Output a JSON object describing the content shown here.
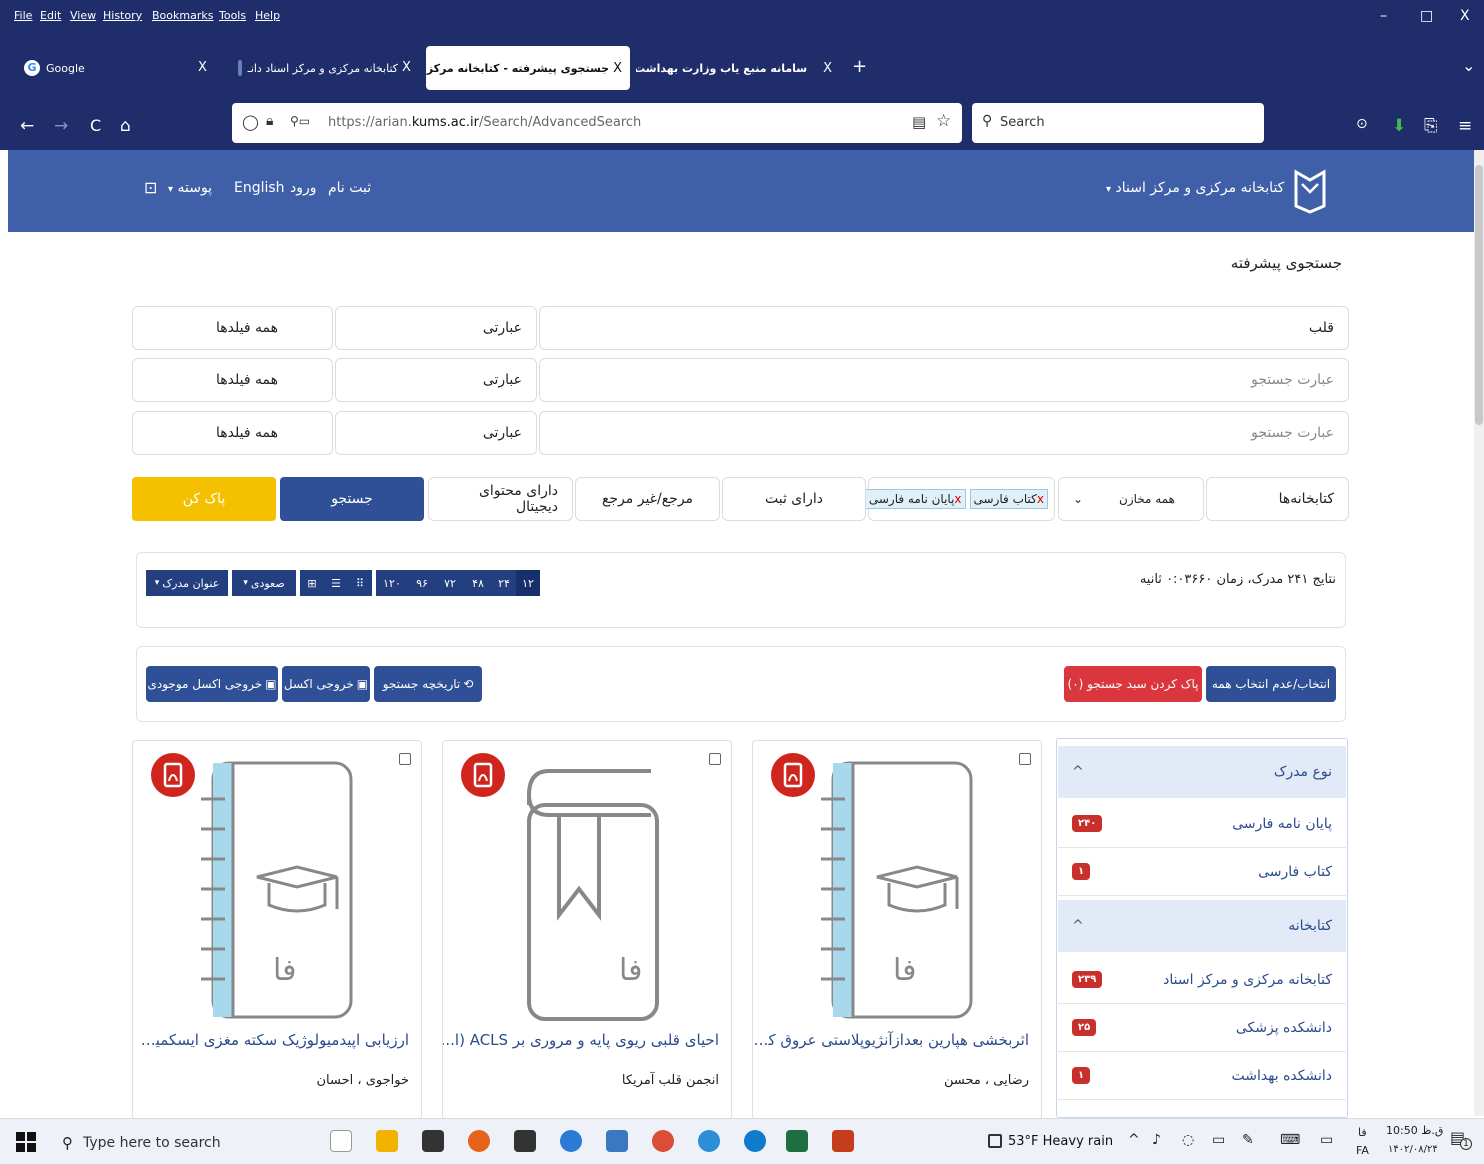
{
  "menubar": {
    "items": [
      "File",
      "Edit",
      "View",
      "History",
      "Bookmarks",
      "Tools",
      "Help"
    ],
    "min": "–",
    "max": "□",
    "close": "X"
  },
  "tabs": {
    "google": {
      "label": "Google",
      "close": "X"
    },
    "library": {
      "label": "کتابخانه مرکزی و مرکز اسناد دانـ",
      "close": "X"
    },
    "advanced": {
      "label": "جستجوی پیشرفته - کتابخانه مرکز",
      "close": "X"
    },
    "ministry": {
      "label": "سامانه منبع یاب وزارت بهداشت",
      "close": "X"
    },
    "new_tab": "+",
    "list_tabs": "⌄"
  },
  "nav": {
    "back": "←",
    "forward": "→",
    "reload": "C",
    "home": "⌂",
    "url_prefix": "https://arian.",
    "url_domain": "kums.ac.ir",
    "url_path": "/Search/AdvancedSearch",
    "search_placeholder": "Search",
    "reader": "▤",
    "star": "☆",
    "shield": "⊙",
    "download": "⬇",
    "share": "⎘",
    "menu": "≡"
  },
  "site": {
    "logo_title": "کتابخانه مرکزی و مرکز اسناد",
    "logo_caret": "▾",
    "nav_links": [
      "ثبت نام",
      "ورود",
      "English",
      "پوسته"
    ],
    "cart": "⊡",
    "caret": "▾"
  },
  "page": {
    "title": "جستجوی پیشرفته"
  },
  "search_rows": [
    {
      "term": "قلب",
      "is_placeholder": false,
      "mode": "عبارتی",
      "field": "همه فیلدها"
    },
    {
      "term": "عبارت جستجو",
      "is_placeholder": true,
      "mode": "عبارتی",
      "field": "همه فیلدها"
    },
    {
      "term": "عبارت جستجو",
      "is_placeholder": true,
      "mode": "عبارتی",
      "field": "همه فیلدها"
    }
  ],
  "filters": {
    "libraries_label": "کتابخانه‌ها",
    "repos": "همه مخازن",
    "tag1": "کتاب فارسی",
    "tag2": "پایان نامه فارسی",
    "registered": "دارای ثبت",
    "reference": "مرجع/غیر مرجع",
    "digital": "دارای محتوای دیجیتال",
    "search_btn": "جستجو",
    "clear_btn": "پاک کن"
  },
  "results": {
    "summary": "نتایج ۲۴۱ مدرک، زمان ۰:۰۳۶۶۰ ثانیه",
    "page_sizes": [
      "۱۲",
      "۲۴",
      "۴۸",
      "۷۲",
      "۹۶",
      "۱۲۰"
    ],
    "sort_field": "عنوان مدرک",
    "sort_dir": "صعودی",
    "caret": "▾"
  },
  "actions": {
    "select_all": "انتخاب/عدم انتخاب همه",
    "clear_basket": "پاک کردن سبد جستجو (۰)",
    "history": "تاریخچه جستجو",
    "excel": "خروجی اکسل",
    "excel_stock": "خروجی اکسل موجودی"
  },
  "facets": {
    "doc_type": {
      "title": "نوع مدرک",
      "items": [
        {
          "label": "پایان نامه فارسی",
          "count": "۲۴۰"
        },
        {
          "label": "کتاب فارسی",
          "count": "۱"
        }
      ]
    },
    "library": {
      "title": "کتابخانه",
      "items": [
        {
          "label": "کتابخانه مرکزی و مرکز اسناد",
          "count": "۲۳۹"
        },
        {
          "label": "دانشکده پزشکی",
          "count": "۲۵"
        },
        {
          "label": "دانشکده بهداشت",
          "count": "۱"
        }
      ]
    },
    "chevron": "^"
  },
  "cards": [
    {
      "title": "اثربخشی هپارین بعدازآنژیوپلاستی عروق کر...",
      "author": "رضایی ، محسن",
      "fa": "فا"
    },
    {
      "title": "احیای قلبی ریوی پایه و مروری بر ACLS (ا...",
      "author": "انجمن قلب آمریکا",
      "fa": "فا"
    },
    {
      "title": "ارزیابی اپیدمیولوژیک سکته مغزی ایسکمیک...",
      "author": "خواجوی ، احسان",
      "fa": "فا"
    }
  ],
  "taskbar": {
    "search_placeholder": "Type here to search",
    "weather": "53°F  Heavy rain",
    "time": "10:50 ق.ظ",
    "date": "۱۴۰۲/۰۸/۲۴",
    "lang": "FA",
    "lang_fa": "فا",
    "notify": "1"
  }
}
